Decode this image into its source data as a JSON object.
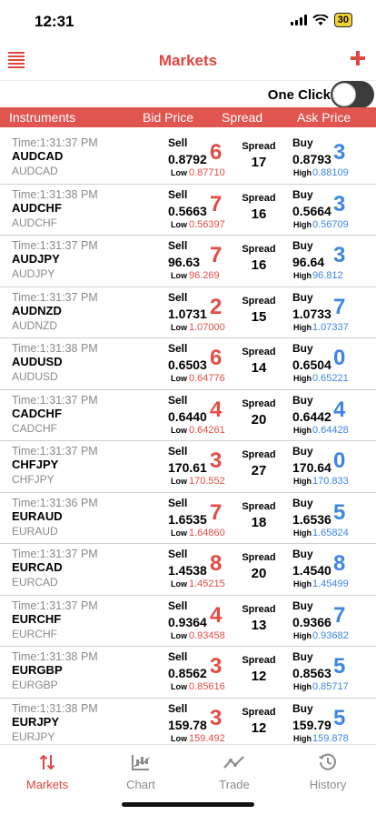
{
  "status": {
    "time": "12:31",
    "battery": "30"
  },
  "nav": {
    "title": "Markets"
  },
  "one_click": {
    "label": "One Click"
  },
  "headers": {
    "instruments": "Instruments",
    "bid": "Bid Price",
    "spread": "Spread",
    "ask": "Ask Price"
  },
  "labels": {
    "sell": "Sell",
    "buy": "Buy",
    "spread": "Spread",
    "low": "Low",
    "high": "High"
  },
  "rows": [
    {
      "time": "Time:1:31:37 PM",
      "symbol": "AUDCAD",
      "sub": "AUDCAD",
      "bid": "0.8792",
      "bid_big": "6",
      "low": "0.87710",
      "spread": "17",
      "ask": "0.8793",
      "ask_big": "3",
      "high": "0.88109"
    },
    {
      "time": "Time:1:31:38 PM",
      "symbol": "AUDCHF",
      "sub": "AUDCHF",
      "bid": "0.5663",
      "bid_big": "7",
      "low": "0.56397",
      "spread": "16",
      "ask": "0.5664",
      "ask_big": "3",
      "high": "0.56709"
    },
    {
      "time": "Time:1:31:37 PM",
      "symbol": "AUDJPY",
      "sub": "AUDJPY",
      "bid": "96.63",
      "bid_big": "7",
      "low": "96.269",
      "spread": "16",
      "ask": "96.64",
      "ask_big": "3",
      "high": "96.812"
    },
    {
      "time": "Time:1:31:37 PM",
      "symbol": "AUDNZD",
      "sub": "AUDNZD",
      "bid": "1.0731",
      "bid_big": "2",
      "low": "1.07000",
      "spread": "15",
      "ask": "1.0733",
      "ask_big": "7",
      "high": "1.07337"
    },
    {
      "time": "Time:1:31:38 PM",
      "symbol": "AUDUSD",
      "sub": "AUDUSD",
      "bid": "0.6503",
      "bid_big": "6",
      "low": "0.64776",
      "spread": "14",
      "ask": "0.6504",
      "ask_big": "0",
      "high": "0.65221"
    },
    {
      "time": "Time:1:31:37 PM",
      "symbol": "CADCHF",
      "sub": "CADCHF",
      "bid": "0.6440",
      "bid_big": "4",
      "low": "0.64261",
      "spread": "20",
      "ask": "0.6442",
      "ask_big": "4",
      "high": "0.64428"
    },
    {
      "time": "Time:1:31:37 PM",
      "symbol": "CHFJPY",
      "sub": "CHFJPY",
      "bid": "170.61",
      "bid_big": "3",
      "low": "170.552",
      "spread": "27",
      "ask": "170.64",
      "ask_big": "0",
      "high": "170.833"
    },
    {
      "time": "Time:1:31:36 PM",
      "symbol": "EURAUD",
      "sub": "EURAUD",
      "bid": "1.6535",
      "bid_big": "7",
      "low": "1.64860",
      "spread": "18",
      "ask": "1.6536",
      "ask_big": "5",
      "high": "1.65824"
    },
    {
      "time": "Time:1:31:37 PM",
      "symbol": "EURCAD",
      "sub": "EURCAD",
      "bid": "1.4538",
      "bid_big": "8",
      "low": "1.45215",
      "spread": "20",
      "ask": "1.4540",
      "ask_big": "8",
      "high": "1.45499"
    },
    {
      "time": "Time:1:31:37 PM",
      "symbol": "EURCHF",
      "sub": "EURCHF",
      "bid": "0.9364",
      "bid_big": "4",
      "low": "0.93458",
      "spread": "13",
      "ask": "0.9366",
      "ask_big": "7",
      "high": "0.93682"
    },
    {
      "time": "Time:1:31:38 PM",
      "symbol": "EURGBP",
      "sub": "EURGBP",
      "bid": "0.8562",
      "bid_big": "3",
      "low": "0.85616",
      "spread": "12",
      "ask": "0.8563",
      "ask_big": "5",
      "high": "0.85717"
    },
    {
      "time": "Time:1:31:38 PM",
      "symbol": "EURJPY",
      "sub": "EURJPY",
      "bid": "159.78",
      "bid_big": "3",
      "low": "159.492",
      "spread": "12",
      "ask": "159.79",
      "ask_big": "5",
      "high": "159.878"
    }
  ],
  "tabs": [
    {
      "label": "Markets",
      "icon": "sort-arrows-icon",
      "active": true
    },
    {
      "label": "Chart",
      "icon": "candlestick-chart-icon",
      "active": false
    },
    {
      "label": "Trade",
      "icon": "trend-line-icon",
      "active": false
    },
    {
      "label": "History",
      "icon": "history-clock-icon",
      "active": false
    }
  ],
  "colors": {
    "accent": "#e0453f",
    "header_bg": "#e0554f",
    "sell": "#e64b44",
    "buy": "#3d86e6"
  }
}
